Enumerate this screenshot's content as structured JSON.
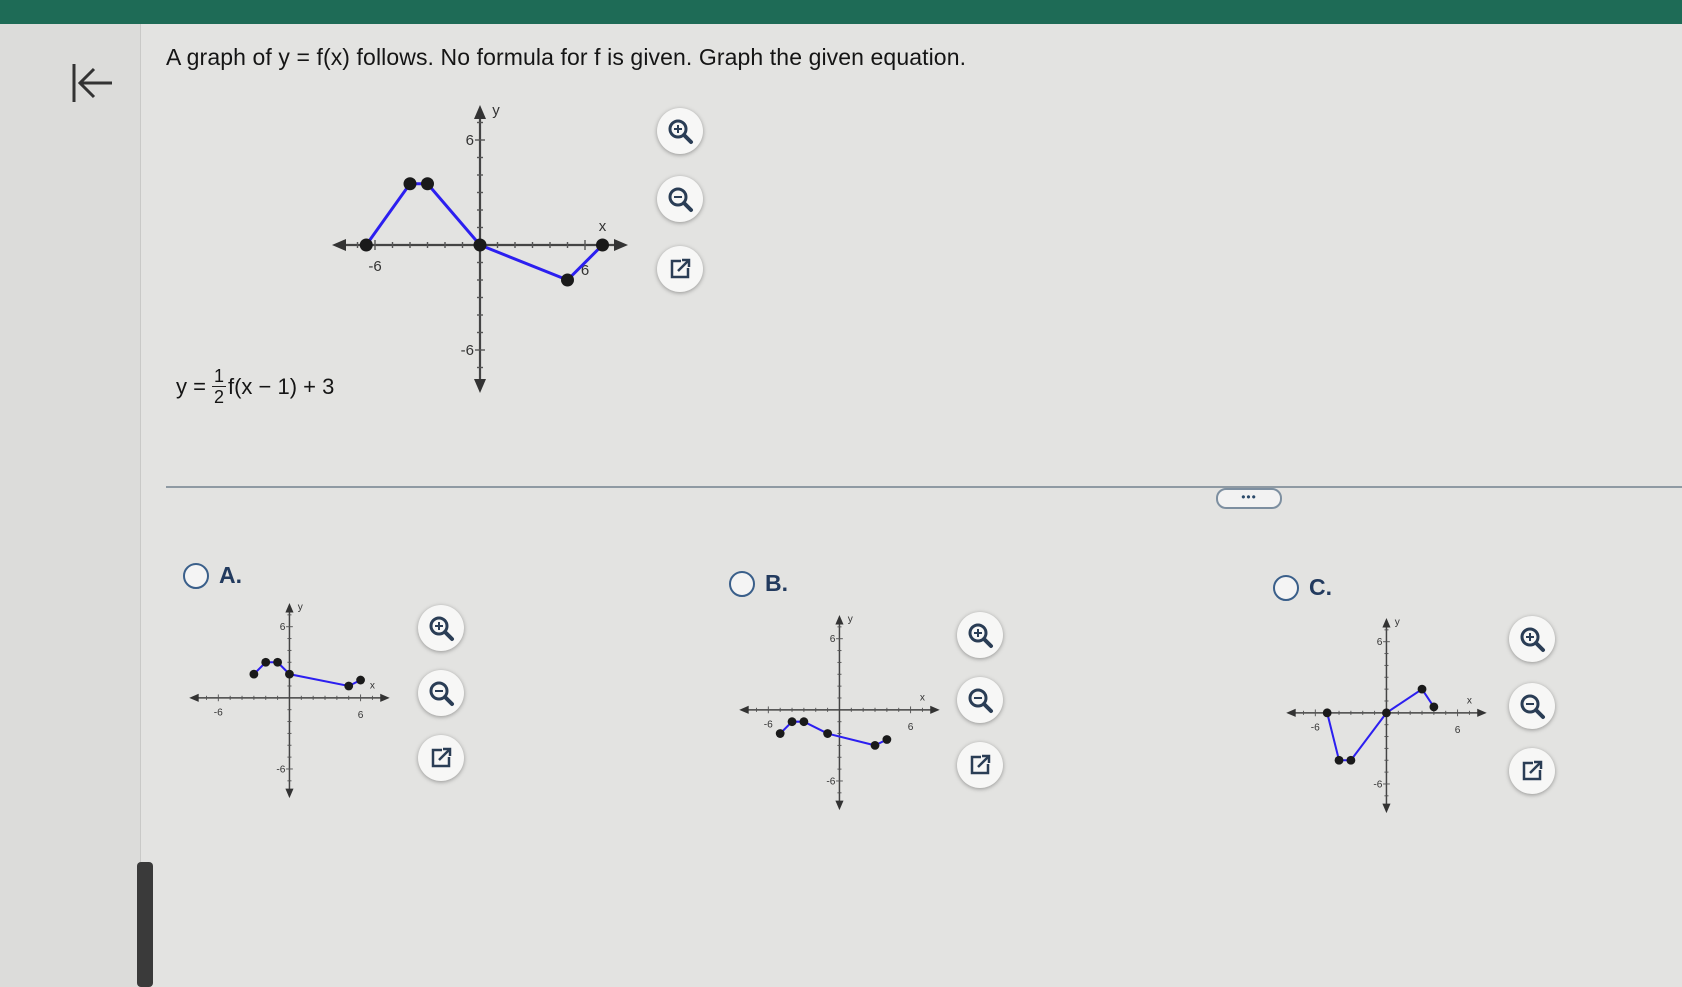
{
  "question": {
    "text": "A graph of y = f(x) follows. No formula for f is given. Graph the given equation."
  },
  "equation": {
    "lhs": "y =",
    "numerator": "1",
    "denominator": "2",
    "rest": "f(x − 1) + 3"
  },
  "divider_more_label": "•••",
  "axis_labels": {
    "x": "x",
    "y": "y",
    "pos": "6",
    "neg": "-6"
  },
  "icons": {
    "back": "back-to-start-icon",
    "zoom_in": "zoom-in-icon",
    "zoom_out": "zoom-out-icon",
    "external": "open-external-icon"
  },
  "colors": {
    "curve": "#2c1ff0",
    "points": "#1a1a1a",
    "accent": "#1e6b56"
  },
  "graphs": {
    "main": [
      [
        -6.5,
        0
      ],
      [
        -4,
        3.5
      ],
      [
        -3,
        3.5
      ],
      [
        0,
        0
      ],
      [
        5,
        -2
      ],
      [
        7,
        0
      ]
    ],
    "A": [
      [
        -3,
        2
      ],
      [
        -2,
        3
      ],
      [
        -1,
        3
      ],
      [
        0,
        2
      ],
      [
        5,
        1
      ],
      [
        6,
        1.5
      ]
    ],
    "B": [
      [
        -5,
        -2
      ],
      [
        -4,
        -1
      ],
      [
        -3,
        -1
      ],
      [
        -1,
        -2
      ],
      [
        3,
        -3
      ],
      [
        4,
        -2.5
      ]
    ],
    "C": [
      [
        -5,
        0
      ],
      [
        -4,
        -4
      ],
      [
        -3,
        -4
      ],
      [
        0,
        0
      ],
      [
        3,
        2
      ],
      [
        4,
        0.5
      ]
    ]
  },
  "options": [
    {
      "label": "A."
    },
    {
      "label": "B."
    },
    {
      "label": "C."
    }
  ]
}
